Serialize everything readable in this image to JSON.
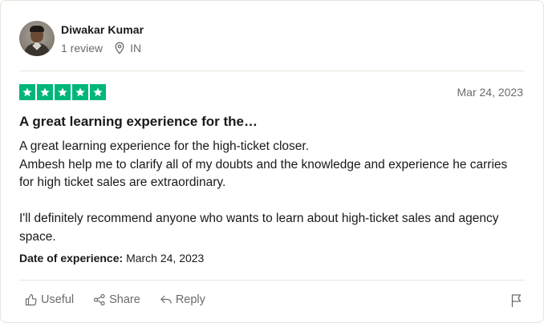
{
  "reviewer": {
    "name": "Diwakar Kumar",
    "review_count": "1 review",
    "country": "IN"
  },
  "review": {
    "rating": 5,
    "rating_max": 5,
    "date": "Mar 24, 2023",
    "title": "A great learning experience for the…",
    "body_lines": [
      "A great learning experience for the high-ticket closer.",
      "Ambesh help me to clarify all of my doubts and the knowledge and experience he carries for high ticket sales are extraordinary.",
      "I'll definitely recommend anyone who wants to learn about high-ticket sales and agency space."
    ],
    "experience_label": "Date of experience:",
    "experience_date": "March 24, 2023"
  },
  "actions": {
    "useful": "Useful",
    "share": "Share",
    "reply": "Reply"
  },
  "colors": {
    "star_green": "#00b67a",
    "muted_text": "#6b6b6b",
    "divider": "#e5e5dd"
  },
  "icons": [
    "location-pin-icon",
    "star-icon",
    "thumbs-up-icon",
    "share-icon",
    "reply-icon",
    "flag-icon"
  ]
}
